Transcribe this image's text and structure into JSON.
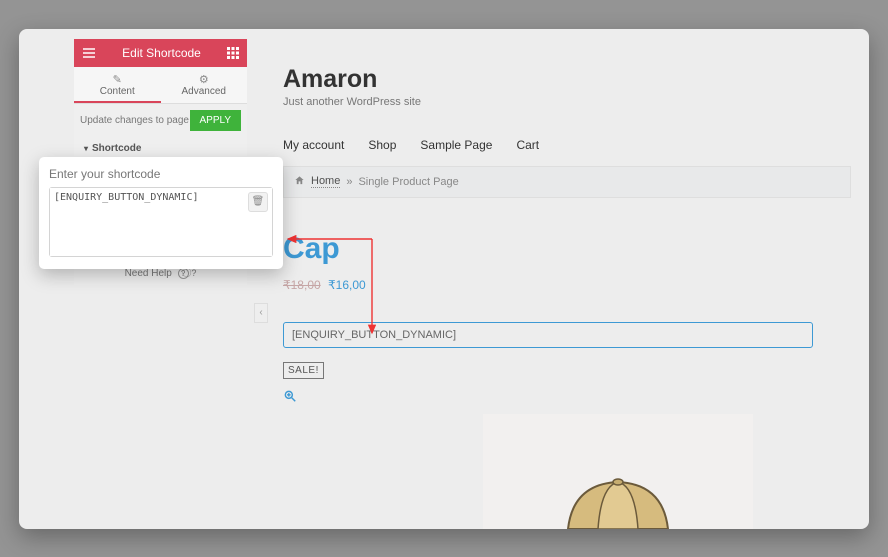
{
  "editor": {
    "header_title": "Edit Shortcode",
    "tab_content": "Content",
    "tab_advanced": "Advanced",
    "update_label": "Update changes to page",
    "apply_label": "APPLY",
    "section_label": "Shortcode",
    "need_help_label": "Need Help"
  },
  "popup": {
    "label": "Enter your shortcode",
    "value": "[ENQUIRY_BUTTON_DYNAMIC]"
  },
  "site": {
    "title": "Amaron",
    "tagline": "Just another WordPress site"
  },
  "nav": {
    "items": [
      "My account",
      "Shop",
      "Sample Page",
      "Cart"
    ]
  },
  "breadcrumb": {
    "home": "Home",
    "separator": "»",
    "current": "Single Product Page"
  },
  "product": {
    "title": "Cap",
    "price_old": "₹18,00",
    "price_new": "₹16,00",
    "shortcode_placeholder": "[ENQUIRY_BUTTON_DYNAMIC]",
    "sale_badge": "SALE!"
  }
}
